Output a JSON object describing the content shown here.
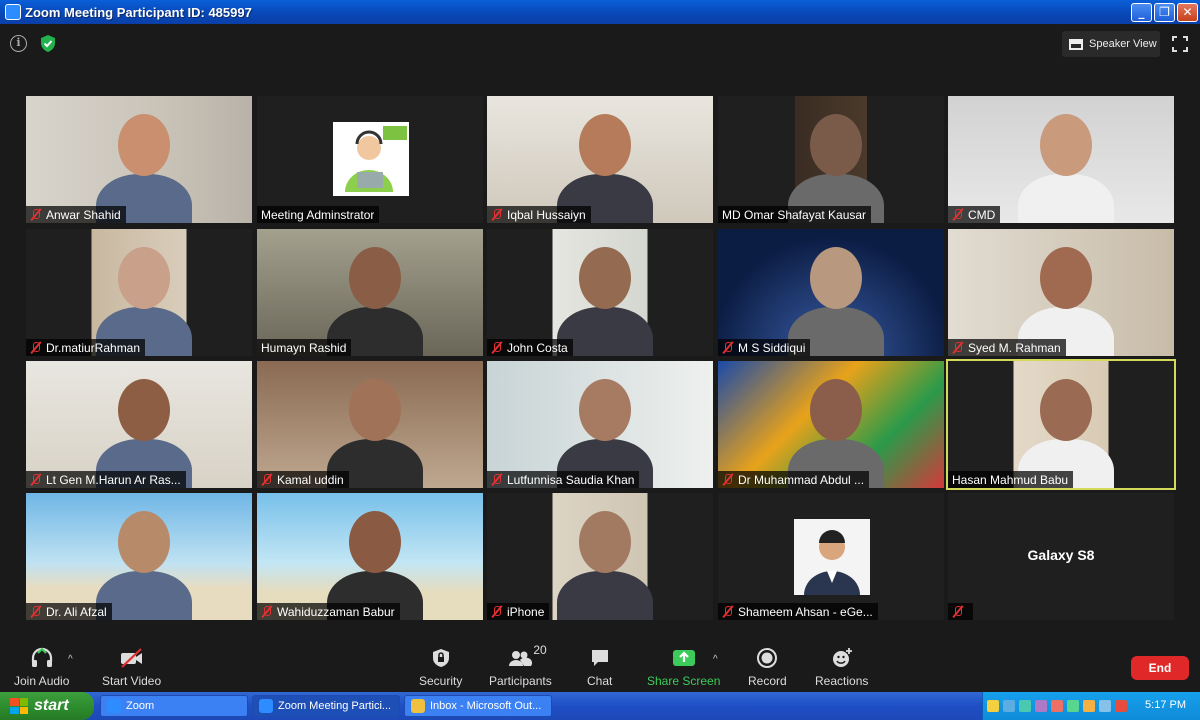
{
  "window": {
    "title": "Zoom Meeting Participant ID: 485997",
    "min": "_",
    "max": "❐",
    "close": "✕"
  },
  "topbar": {
    "speaker_view": "Speaker View"
  },
  "participants": [
    {
      "name": "Anwar Shahid",
      "muted": true
    },
    {
      "name": "Meeting Adminstrator",
      "muted": false
    },
    {
      "name": "Iqbal Hussaiyn",
      "muted": true
    },
    {
      "name": "MD Omar Shafayat Kausar",
      "muted": false
    },
    {
      "name": "CMD",
      "muted": true
    },
    {
      "name": "Dr.matiurRahman",
      "muted": true
    },
    {
      "name": "Humayn Rashid",
      "muted": false
    },
    {
      "name": "John Costa",
      "muted": true
    },
    {
      "name": "M S Siddiqui",
      "muted": true
    },
    {
      "name": "Syed M. Rahman",
      "muted": true
    },
    {
      "name": "Lt Gen M.Harun Ar Ras...",
      "muted": true
    },
    {
      "name": "Kamal uddin",
      "muted": true
    },
    {
      "name": "Lutfunnisa Saudia Khan",
      "muted": true
    },
    {
      "name": "Dr Muhammad Abdul ...",
      "muted": true
    },
    {
      "name": "Hasan Mahmud Babu",
      "muted": false
    },
    {
      "name": "Dr. Ali Afzal",
      "muted": true
    },
    {
      "name": "Wahiduzzaman Babur",
      "muted": true
    },
    {
      "name": "iPhone",
      "muted": true
    },
    {
      "name": "Shameem Ahsan - eGe...",
      "muted": true
    },
    {
      "name": "",
      "muted": true,
      "label": "Galaxy S8"
    }
  ],
  "toolbar": {
    "join_audio": "Join Audio",
    "start_video": "Start Video",
    "security": "Security",
    "participants": "Participants",
    "participants_count": "20",
    "chat": "Chat",
    "share_screen": "Share Screen",
    "record": "Record",
    "reactions": "Reactions",
    "end": "End",
    "caret": "^"
  },
  "taskbar": {
    "start": "start",
    "tasks": [
      "Zoom",
      "Zoom Meeting Partici...",
      "Inbox - Microsoft Out..."
    ],
    "clock": "5:17 PM"
  },
  "colors": {
    "active_speaker": "#d4d95a",
    "share_green": "#3ccb5a",
    "end_red": "#e02828"
  }
}
